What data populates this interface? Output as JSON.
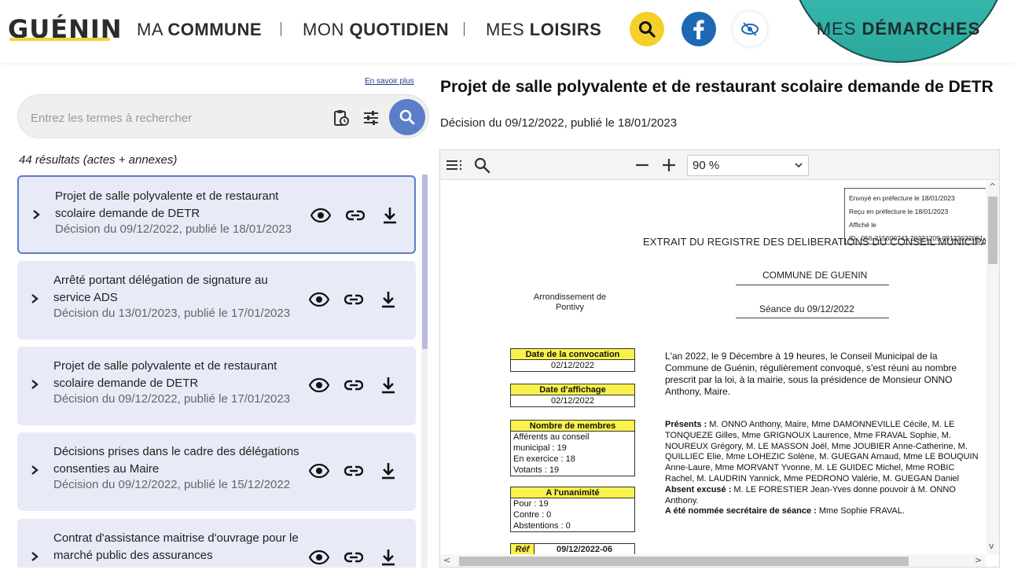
{
  "header": {
    "logo": "GUÉNIN",
    "nav": [
      {
        "pre": "MA ",
        "bold": "COMMUNE"
      },
      {
        "pre": "MON ",
        "bold": "QUOTIDIEN"
      },
      {
        "pre": "MES ",
        "bold": "LOISIRS"
      }
    ],
    "demarches": {
      "pre": "MES ",
      "bold": "DÉMARCHES"
    },
    "colors": {
      "accent_yellow": "#f6cf2a",
      "facebook": "#1e69b6",
      "teal": "#3fc2b7"
    },
    "icons": [
      "search-icon",
      "facebook-icon",
      "accessibility-icon"
    ]
  },
  "search": {
    "help_link": "En savoir plus",
    "placeholder": "Entrez les termes à rechercher",
    "results_count": "44 résultats (actes + annexes)"
  },
  "results": [
    {
      "title": "Projet de salle polyvalente et de restaurant scolaire demande de DETR",
      "meta": "Décision du 09/12/2022, publié le 18/01/2023",
      "selected": true
    },
    {
      "title": "Arrêté portant délégation de signature au service ADS",
      "meta": "Décision du 13/01/2023, publié le 17/01/2023",
      "selected": false
    },
    {
      "title": "Projet de salle polyvalente et de restaurant scolaire demande de DETR",
      "meta": "Décision du 09/12/2022, publié le 17/01/2023",
      "selected": false
    },
    {
      "title": "Décisions prises dans le cadre des délégations consenties au Maire",
      "meta": "Décision du 09/12/2022, publié le 15/12/2022",
      "selected": false
    },
    {
      "title": "Contrat d'assistance maitrise d'ouvrage pour le marché public des assurances",
      "meta": "",
      "selected": false
    }
  ],
  "document": {
    "title": "Projet de salle polyvalente et de restaurant scolaire demande de DETR",
    "date_line": "Décision du 09/12/2022, publié le 18/01/2023",
    "zoom": "90 %",
    "page": {
      "stamp": [
        "Envoyé en préfecture le 18/01/2023",
        "Reçu en préfecture le 18/01/2023",
        "Affiché le",
        "ID : 056-215600743-20221209-09122022061-DE"
      ],
      "heading": "EXTRAIT DU REGISTRE DES DELIBERATIONS DU CONSEIL MUNICIPAL",
      "commune": "COMMUNE DE GUENIN",
      "seance": "Séance du 09/12/2022",
      "arrondissement": "Arrondissement de Pontivy",
      "convocation_label": "Date de la convocation",
      "convocation_value": "02/12/2022",
      "affichage_label": "Date d'affichage",
      "affichage_value": "02/12/2022",
      "membres_label": "Nombre de membres",
      "membres_lines": [
        "Afférents au conseil",
        "municipal : 19",
        "En exercice : 18",
        "Votants : 19"
      ],
      "unanimite_label": "A l'unanimité",
      "unanimite_lines": [
        "Pour : 19",
        "Contre : 0",
        "Abstentions : 0"
      ],
      "ref_label": "Réf",
      "ref_value": "09/12/2022-06",
      "intro_lines": [
        "L'an 2022, le 9 Décembre à 19 heures, le Conseil Municipal de la",
        "Commune de Guénin, régulièrement convoqué, s'est réuni au nombre",
        "prescrit par la loi, à la mairie, sous la présidence de Monsieur ONNO",
        "Anthony, Maire."
      ],
      "presents_label": "Présents :",
      "presents_lines": [
        " M. ONNO Anthony, Maire, Mme DAMONNEVILLE Cécile, M. LE",
        "TONQUEZE Gilles, Mme GRIGNOUX Laurence, Mme FRAVAL Sophie, M.",
        "NOUREUX Grégory, M. LE MASSON Joël, Mme JOUBIER Anne-Catherine, M.",
        "QUILLIEC Elie, Mme LOHEZIC Solène, M. GUEGAN Arnaud, Mme LE BOUQUIN",
        "Anne-Laure, Mme MORVANT Yvonne, M. LE GUIDEC Michel, Mme ROBIC",
        "Rachel, M. LAUDRIN Yannick, Mme PEDRONO Valérie, M. GUEGAN Daniel"
      ],
      "absent_label": "Absent excusé :",
      "absent_line": " M. LE FORESTIER Jean-Yves donne pouvoir à M. ONNO",
      "absent_line2": "Anthony.",
      "secretaire_label": "A été nommée secrétaire de séance :",
      "secretaire_value": " Mme Sophie FRAVAL."
    }
  }
}
